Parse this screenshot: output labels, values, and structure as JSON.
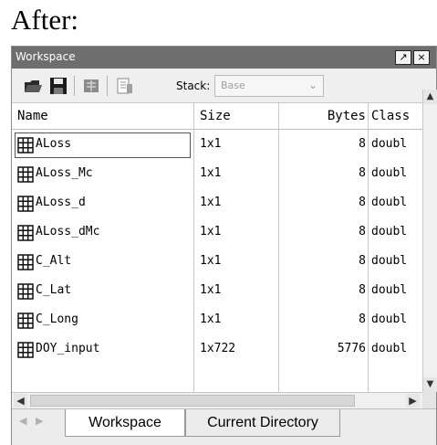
{
  "caption": "After:",
  "window": {
    "title": "Workspace",
    "controls": {
      "undock": "↗",
      "close": "×"
    }
  },
  "toolbar": {
    "icons": [
      "open-folder-icon",
      "save-icon",
      "new-variable-icon",
      "print-icon"
    ],
    "stack_label": "Stack:",
    "stack_value": "Base"
  },
  "table": {
    "columns": [
      "Name",
      "Size",
      "Bytes",
      "Class"
    ],
    "rows": [
      {
        "name": "ALoss",
        "size": "1x1",
        "bytes": "8",
        "class": "doubl"
      },
      {
        "name": "ALoss_Mc",
        "size": "1x1",
        "bytes": "8",
        "class": "doubl"
      },
      {
        "name": "ALoss_d",
        "size": "1x1",
        "bytes": "8",
        "class": "doubl"
      },
      {
        "name": "ALoss_dMc",
        "size": "1x1",
        "bytes": "8",
        "class": "doubl"
      },
      {
        "name": "C_Alt",
        "size": "1x1",
        "bytes": "8",
        "class": "doubl"
      },
      {
        "name": "C_Lat",
        "size": "1x1",
        "bytes": "8",
        "class": "doubl"
      },
      {
        "name": "C_Long",
        "size": "1x1",
        "bytes": "8",
        "class": "doubl"
      },
      {
        "name": "DOY_input",
        "size": "1x722",
        "bytes": "5776",
        "class": "doubl"
      }
    ]
  },
  "tabs": [
    {
      "label": "Workspace",
      "active": true
    },
    {
      "label": "Current Directory",
      "active": false
    }
  ]
}
